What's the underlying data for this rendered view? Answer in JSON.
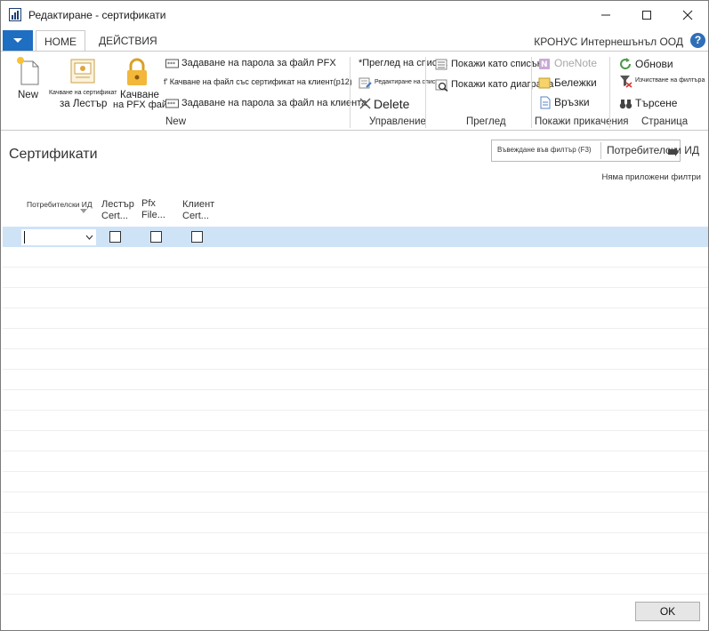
{
  "window": {
    "title": "Редактиране - сертификати"
  },
  "ribbon_tabs": {
    "home": "HOME",
    "actions": "ДЕЙСТВИЯ"
  },
  "company": "КРОНУС Интернешънъл ООД",
  "help": "?",
  "ribbon": {
    "new_group": {
      "label": "New",
      "new_btn": "New",
      "upload_cert_small": "Качване на сертификат",
      "upload_cert_for_lester": "за Лестър",
      "upload_pfx_line1": "Качване",
      "upload_pfx_line2": "на PFX файл",
      "set_pfx_password": "Задаване на парола за файл PFX",
      "upload_client_cert": "f' Качване на файл със сертификат на клиент(p12)",
      "set_client_password": "Задаване на парола за файл на клиента"
    },
    "manage_group": {
      "label": "Управление",
      "view_list": "*Преглед на списък",
      "edit_list": "Редактиране на списък",
      "delete": "Delete"
    },
    "view_group": {
      "label": "Преглед",
      "show_as_list": "Покажи като списък",
      "show_as_chart": "Покажи като диаграма"
    },
    "attachments_group": {
      "label": "Покажи прикачения",
      "onenote": "OneNote",
      "notes": "Бележки",
      "links": "Връзки"
    },
    "page_group": {
      "label": "Страница",
      "refresh": "Обнови",
      "clear_filter": "Изчистване на филтъра",
      "find": "Търсене"
    }
  },
  "page": {
    "title": "Сертификати",
    "filter_placeholder": "Въвеждане във филтър (F3)",
    "filter_field": "Потребителски ИД",
    "no_filters": "Няма приложени филтри"
  },
  "grid": {
    "columns": [
      {
        "line1": "Потребителски ИД",
        "line2": ""
      },
      {
        "line1": "Лестър",
        "line2": "Cert..."
      },
      {
        "line1": "Pfx",
        "line2": "File..."
      },
      {
        "line1": "Клиент",
        "line2": "Cert..."
      }
    ],
    "rows": [
      {
        "user_id": "",
        "lester_cert": false,
        "pfx_file": false,
        "client_cert": false
      }
    ]
  },
  "footer": {
    "ok": "OK"
  },
  "colors": {
    "accent": "#1e6ec2",
    "selected_row": "#cfe3f7"
  }
}
